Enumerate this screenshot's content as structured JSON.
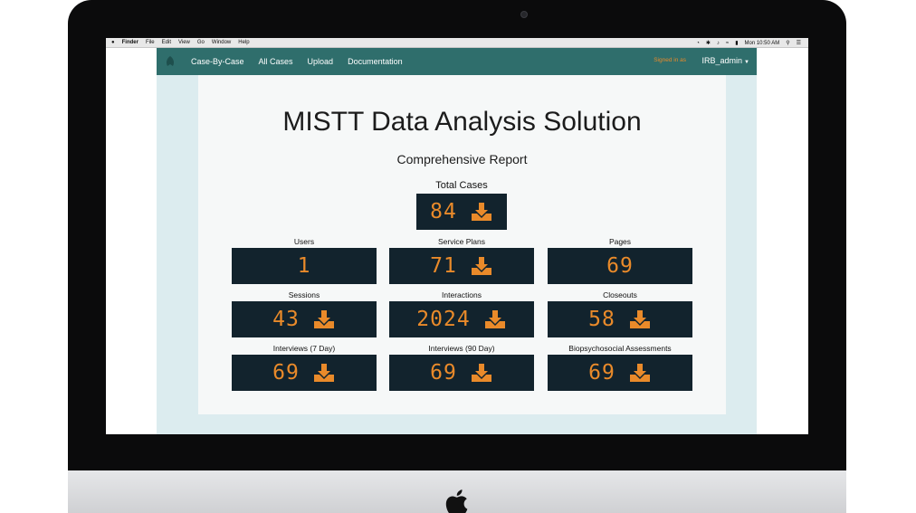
{
  "menubar": {
    "apple": "",
    "items": [
      "Finder",
      "File",
      "Edit",
      "View",
      "Go",
      "Window",
      "Help"
    ],
    "clock": "Mon 10:50 AM"
  },
  "navbar": {
    "links": [
      "Case-By-Case",
      "All Cases",
      "Upload",
      "Documentation"
    ],
    "signed_in_label": "Signed in as",
    "user": "IRB_admin"
  },
  "report": {
    "title": "MISTT Data Analysis Solution",
    "subtitle": "Comprehensive Report"
  },
  "stats": {
    "total_cases": {
      "label": "Total Cases",
      "value": "84",
      "download": true
    },
    "users": {
      "label": "Users",
      "value": "1",
      "download": false
    },
    "service_plans": {
      "label": "Service Plans",
      "value": "71",
      "download": true
    },
    "pages": {
      "label": "Pages",
      "value": "69",
      "download": false
    },
    "sessions": {
      "label": "Sessions",
      "value": "43",
      "download": true
    },
    "interactions": {
      "label": "Interactions",
      "value": "2024",
      "download": true
    },
    "closeouts": {
      "label": "Closeouts",
      "value": "58",
      "download": true
    },
    "interviews_7": {
      "label": "Interviews (7 Day)",
      "value": "69",
      "download": true
    },
    "interviews_90": {
      "label": "Interviews (90 Day)",
      "value": "69",
      "download": true
    },
    "biopsychosocial": {
      "label": "Biopsychosocial Assessments",
      "value": "69",
      "download": true
    }
  },
  "colors": {
    "navbar": "#2f6e6c",
    "accent": "#e98a2a",
    "stat_box": "#12232d",
    "page_bg": "#dcecef"
  }
}
